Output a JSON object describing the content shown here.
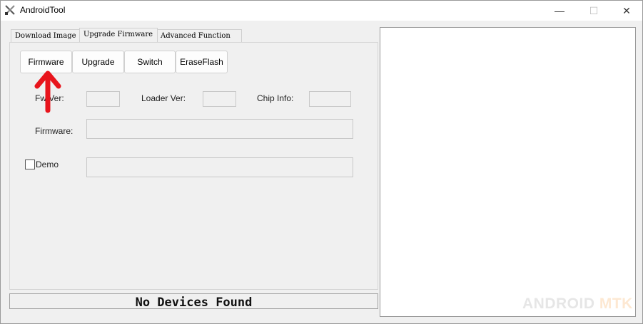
{
  "window": {
    "title": "AndroidTool",
    "minimize_glyph": "—",
    "maximize_glyph": "☐",
    "close_glyph": "✕"
  },
  "tabs": [
    {
      "label": "Download Image",
      "active": false
    },
    {
      "label": "Upgrade Firmware",
      "active": true
    },
    {
      "label": "Advanced Function",
      "active": false
    }
  ],
  "toolbar": {
    "firmware_label": "Firmware",
    "upgrade_label": "Upgrade",
    "switch_label": "Switch",
    "eraseflash_label": "EraseFlash"
  },
  "info": {
    "fw_ver_label": "Fw Ver:",
    "fw_ver_value": "",
    "loader_ver_label": "Loader Ver:",
    "loader_ver_value": "",
    "chip_info_label": "Chip Info:",
    "chip_info_value": "",
    "firmware_label": "Firmware:",
    "firmware_value": "",
    "demo_label": "Demo",
    "demo_checked": false,
    "demo_value": ""
  },
  "status": {
    "text": "No Devices Found"
  },
  "watermark": {
    "part1": "ANDROID",
    "part2": "MTK"
  },
  "colors": {
    "annotation_arrow": "#e8141c",
    "background": "#f0f0f0",
    "log_background": "#ffffff"
  }
}
